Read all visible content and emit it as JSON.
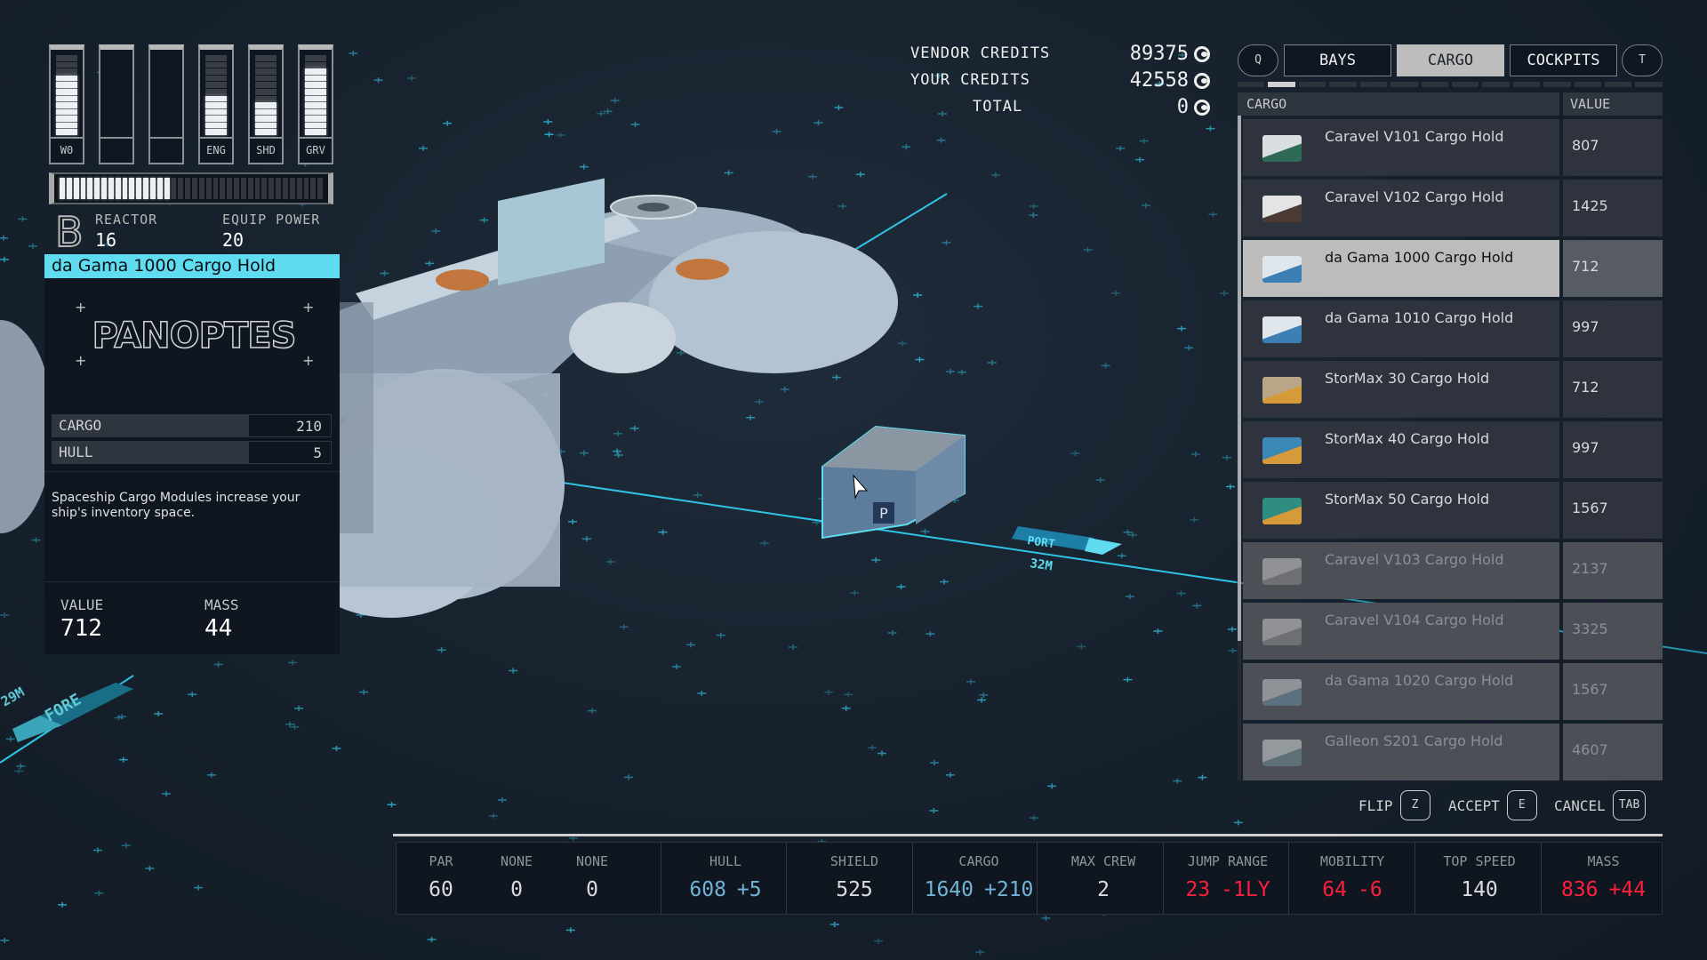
{
  "colors": {
    "accent_cyan": "#5fdcf0",
    "positive_blue": "#6fb3d6",
    "negative_red": "#ff1f3d",
    "panel_bg": "#0f1620",
    "active_tab": "#bdbdbd"
  },
  "power": {
    "columns": [
      {
        "label": "W0",
        "filled": 9,
        "total": 12
      },
      {
        "label": "",
        "filled": 0,
        "total": 0
      },
      {
        "label": "",
        "filled": 0,
        "total": 0
      },
      {
        "label": "ENG",
        "filled": 6,
        "total": 12
      },
      {
        "label": "SHD",
        "filled": 5,
        "total": 12
      },
      {
        "label": "GRV",
        "filled": 10,
        "total": 12
      }
    ],
    "reactor_bar": {
      "filled": 16,
      "total": 38
    },
    "class_letter": "B",
    "reactor_label": "REACTOR",
    "reactor_value": "16",
    "equip_power_label": "EQUIP POWER",
    "equip_power_value": "20"
  },
  "item_card": {
    "title": "da Gama 1000 Cargo Hold",
    "manufacturer_logo": "PANOPTES",
    "stats": [
      {
        "label": "CARGO",
        "value": "210"
      },
      {
        "label": "HULL",
        "value": "5"
      }
    ],
    "description": "Spaceship Cargo Modules increase your ship's inventory space.",
    "value_label": "VALUE",
    "value": "712",
    "mass_label": "MASS",
    "mass": "44"
  },
  "credits": {
    "vendor_label": "VENDOR CREDITS",
    "vendor_value": "89375",
    "your_label": "YOUR CREDITS",
    "your_value": "42558",
    "total_label": "TOTAL",
    "total_value": "0",
    "currency_icon": "credits-icon"
  },
  "tabs": {
    "prev_key": "Q",
    "next_key": "T",
    "items": [
      {
        "label": "BAYS",
        "active": false
      },
      {
        "label": "CARGO",
        "active": true
      },
      {
        "label": "COCKPITS",
        "active": false
      }
    ],
    "indicator": {
      "count": 14,
      "active_index": 1
    }
  },
  "list": {
    "col_name": "CARGO",
    "col_value": "VALUE",
    "scroll_fraction_visible": 0.79,
    "rows": [
      {
        "name": "Caravel V101 Cargo Hold",
        "value": "807",
        "state": "normal",
        "thumb": "caravel-green"
      },
      {
        "name": "Caravel V102 Cargo Hold",
        "value": "1425",
        "state": "normal",
        "thumb": "caravel-white"
      },
      {
        "name": "da Gama 1000 Cargo Hold",
        "value": "712",
        "state": "selected",
        "thumb": "dagama"
      },
      {
        "name": "da Gama 1010 Cargo Hold",
        "value": "997",
        "state": "normal",
        "thumb": "dagama"
      },
      {
        "name": "StorMax 30 Cargo Hold",
        "value": "712",
        "state": "normal",
        "thumb": "stormax-tan"
      },
      {
        "name": "StorMax 40 Cargo Hold",
        "value": "997",
        "state": "normal",
        "thumb": "stormax-blue"
      },
      {
        "name": "StorMax 50 Cargo Hold",
        "value": "1567",
        "state": "normal",
        "thumb": "stormax-teal"
      },
      {
        "name": "Caravel V103 Cargo Hold",
        "value": "2137",
        "state": "dim",
        "thumb": "caravel-grey"
      },
      {
        "name": "Caravel V104 Cargo Hold",
        "value": "3325",
        "state": "dim",
        "thumb": "caravel-grey"
      },
      {
        "name": "da Gama 1020 Cargo Hold",
        "value": "1567",
        "state": "dim",
        "thumb": "dagama-grey"
      },
      {
        "name": "Galleon S201 Cargo Hold",
        "value": "4607",
        "state": "dim",
        "thumb": "galleon"
      }
    ]
  },
  "actions": [
    {
      "label": "FLIP",
      "key": "Z"
    },
    {
      "label": "ACCEPT",
      "key": "E"
    },
    {
      "label": "CANCEL",
      "key": "TAB"
    }
  ],
  "scene": {
    "port_label": "PORT",
    "port_distance": "32M",
    "fore_label": "FORE",
    "fore_distance": "29M",
    "module_badge": "P",
    "module_logo": "PANOPTES"
  },
  "ship_stats": [
    {
      "label": "PAR",
      "value": "60",
      "delta": "",
      "tone": "normal"
    },
    {
      "label": "NONE",
      "value": "0",
      "delta": "",
      "tone": "normal"
    },
    {
      "label": "NONE",
      "value": "0",
      "delta": "",
      "tone": "normal"
    },
    {
      "label": "HULL",
      "value": "608",
      "delta": "+5",
      "tone": "blue"
    },
    {
      "label": "SHIELD",
      "value": "525",
      "delta": "",
      "tone": "normal"
    },
    {
      "label": "CARGO",
      "value": "1640",
      "delta": "+210",
      "tone": "blue"
    },
    {
      "label": "MAX CREW",
      "value": "2",
      "delta": "",
      "tone": "normal"
    },
    {
      "label": "JUMP RANGE",
      "value": "23",
      "delta": "-1LY",
      "tone": "red"
    },
    {
      "label": "MOBILITY",
      "value": "64",
      "delta": "-6",
      "tone": "red"
    },
    {
      "label": "TOP SPEED",
      "value": "140",
      "delta": "",
      "tone": "normal"
    },
    {
      "label": "MASS",
      "value": "836",
      "delta": "+44",
      "tone": "red"
    }
  ]
}
